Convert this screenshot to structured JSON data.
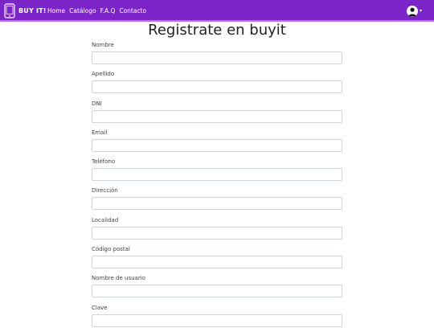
{
  "brand": {
    "name": "BUY IT!"
  },
  "nav": {
    "links": [
      {
        "label": "Home"
      },
      {
        "label": "Catálogo"
      },
      {
        "label": "F.A.Q"
      },
      {
        "label": "Contacto"
      }
    ]
  },
  "user_menu": {
    "icon": "user-avatar-icon",
    "caret": "▾"
  },
  "page": {
    "title": "Registrate en buyit"
  },
  "form": {
    "fields": [
      {
        "label": "Nombre",
        "value": "",
        "placeholder": ""
      },
      {
        "label": "Apellido",
        "value": "",
        "placeholder": ""
      },
      {
        "label": "DNI",
        "value": "",
        "placeholder": ""
      },
      {
        "label": "Email",
        "value": "",
        "placeholder": ""
      },
      {
        "label": "Teléfono",
        "value": "",
        "placeholder": ""
      },
      {
        "label": "Dirección",
        "value": "",
        "placeholder": ""
      },
      {
        "label": "Localidad",
        "value": "",
        "placeholder": ""
      },
      {
        "label": "Código postal",
        "value": "",
        "placeholder": ""
      },
      {
        "label": "Nombre de usuario",
        "value": "",
        "placeholder": ""
      },
      {
        "label": "Clave",
        "value": "",
        "placeholder": ""
      }
    ]
  },
  "colors": {
    "navbar": "#7b25c9",
    "navbar_border": "#c06ff0",
    "input_border": "#cfd4d9"
  }
}
